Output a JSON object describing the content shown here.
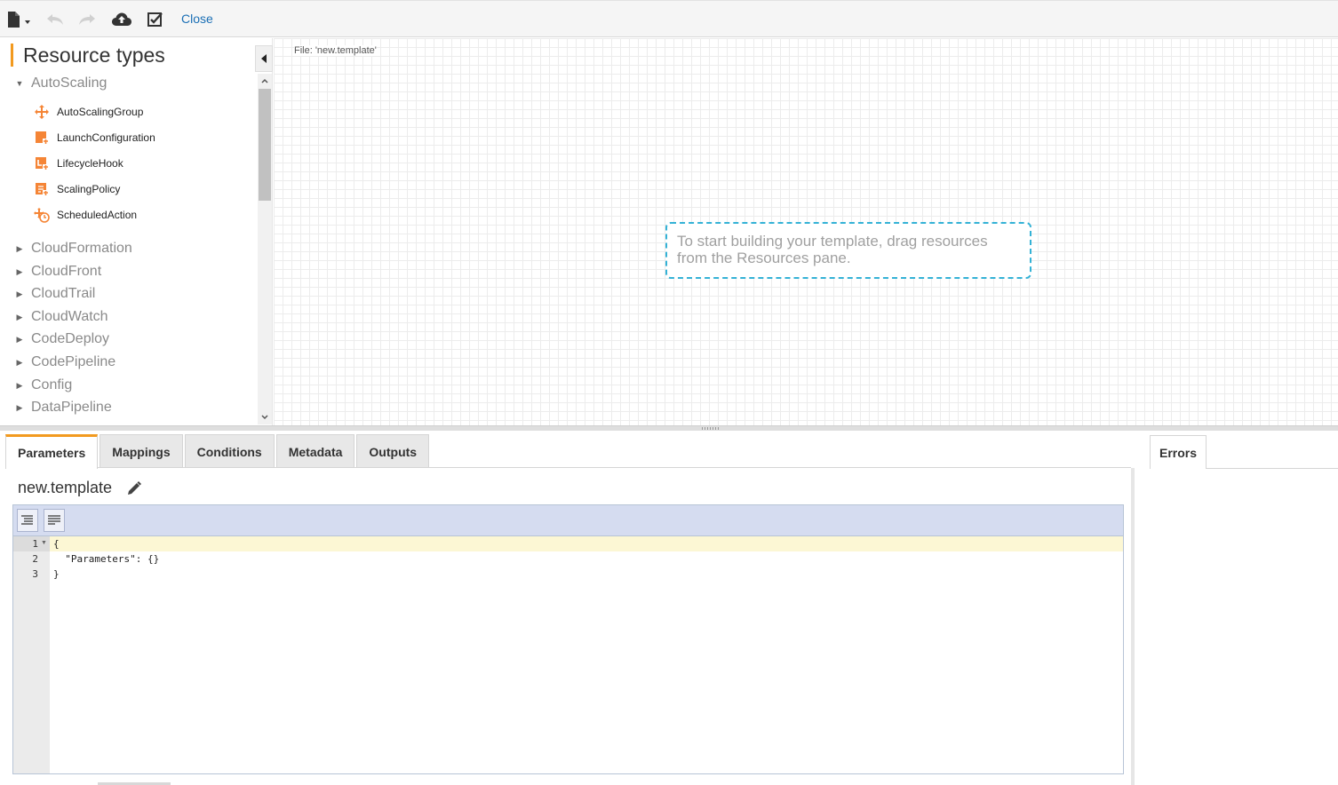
{
  "toolbar": {
    "close_label": "Close",
    "icons": [
      "file-menu-icon",
      "undo-icon",
      "redo-icon",
      "cloud-upload-icon",
      "validate-icon"
    ]
  },
  "left_panel": {
    "title": "Resource types",
    "expanded_group": {
      "label": "AutoScaling",
      "items": [
        {
          "label": "AutoScalingGroup",
          "icon": "autoscaling-group-icon"
        },
        {
          "label": "LaunchConfiguration",
          "icon": "launch-configuration-icon"
        },
        {
          "label": "LifecycleHook",
          "icon": "lifecycle-hook-icon"
        },
        {
          "label": "ScalingPolicy",
          "icon": "scaling-policy-icon"
        },
        {
          "label": "ScheduledAction",
          "icon": "scheduled-action-icon"
        }
      ]
    },
    "groups": [
      "CloudFormation",
      "CloudFront",
      "CloudTrail",
      "CloudWatch",
      "CodeDeploy",
      "CodePipeline",
      "Config",
      "DataPipeline"
    ]
  },
  "canvas": {
    "file_label": "File: 'new.template'",
    "hint": "To start building your template, drag resources from the Resources pane."
  },
  "bottom": {
    "tabs": [
      "Parameters",
      "Mappings",
      "Conditions",
      "Metadata",
      "Outputs"
    ],
    "active_tab": "Parameters",
    "errors_tab": "Errors",
    "template_name": "new.template",
    "code_lines": [
      {
        "num": "1",
        "text": "{"
      },
      {
        "num": "2",
        "text": "  \"Parameters\": {}"
      },
      {
        "num": "3",
        "text": "}"
      }
    ]
  },
  "colors": {
    "accent": "#f29a1f",
    "hint_border": "#34b2d6",
    "link": "#1a6fb5",
    "icon_orange": "#f58536"
  }
}
